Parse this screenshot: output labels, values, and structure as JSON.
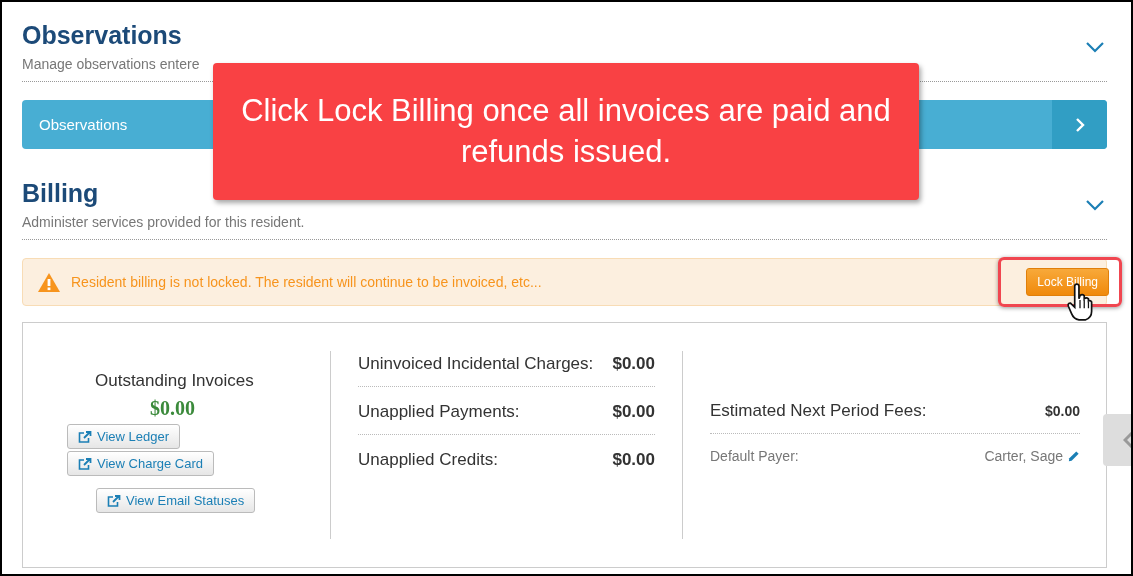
{
  "sections": [
    {
      "title": "Observations",
      "subtitle": "Manage observations entere",
      "expanded": true
    },
    {
      "title": "Billing",
      "subtitle": "Administer services provided for this resident.",
      "expanded": true
    }
  ],
  "observations_bar": {
    "label": "Observations"
  },
  "callout": {
    "text": "Click Lock Billing once all invoices are paid and refunds issued."
  },
  "alert": {
    "message": "Resident billing is not locked. The resident will continue to be invoiced, etc...",
    "button": "Lock Billing",
    "highlighted": true
  },
  "outstanding": {
    "label": "Outstanding Invoices",
    "amount": "$0.00",
    "buttons": [
      "View Ledger",
      "View Charge Card",
      "View Email Statuses"
    ]
  },
  "charges": [
    {
      "label": "Uninvoiced Incidental Charges:",
      "value": "$0.00"
    },
    {
      "label": "Unapplied Payments:",
      "value": "$0.00"
    },
    {
      "label": "Unapplied Credits:",
      "value": "$0.00"
    }
  ],
  "fees": {
    "label": "Estimated Next Period Fees:",
    "value": "$0.00"
  },
  "payer": {
    "label": "Default Payer:",
    "value": "Carter, Sage"
  }
}
